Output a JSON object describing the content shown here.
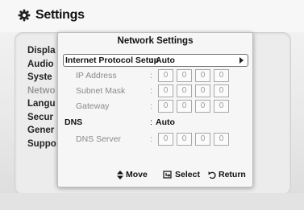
{
  "app": {
    "title": "Settings",
    "icon": "gear-icon"
  },
  "menu": {
    "items": [
      {
        "label": "Displa",
        "dim": false
      },
      {
        "label": "Audio",
        "dim": false
      },
      {
        "label": "Syste",
        "dim": false
      },
      {
        "label": "Netwo",
        "dim": true
      },
      {
        "label": "Langu",
        "dim": false
      },
      {
        "label": "Secur",
        "dim": false
      },
      {
        "label": "Gener",
        "dim": false
      },
      {
        "label": "Suppo",
        "dim": false
      }
    ]
  },
  "dialog": {
    "title": "Network Settings",
    "ip_setup": {
      "label": "Internet Protocol Setup",
      "value": "Auto"
    },
    "ip_address": {
      "label": "IP Address",
      "octets": [
        "0",
        "0",
        "0",
        "0"
      ]
    },
    "subnet_mask": {
      "label": "Subnet Mask",
      "octets": [
        "0",
        "0",
        "0",
        "0"
      ]
    },
    "gateway": {
      "label": "Gateway",
      "octets": [
        "0",
        "0",
        "0",
        "0"
      ]
    },
    "dns": {
      "label": "DNS",
      "value": "Auto"
    },
    "dns_server": {
      "label": "DNS Server",
      "octets": [
        "0",
        "0",
        "0",
        "0"
      ]
    },
    "colon": ":",
    "footer": {
      "move": "Move",
      "select": "Select",
      "return": "Return"
    }
  },
  "colors": {
    "highlight_border": "#6f6f6f",
    "dim_text": "#8a8a8a"
  }
}
